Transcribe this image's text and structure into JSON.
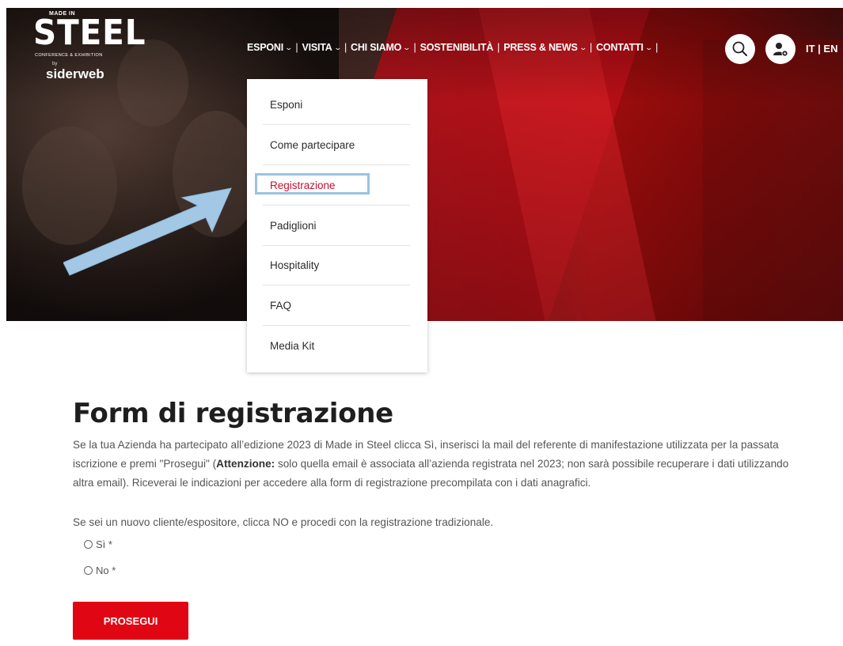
{
  "logo": {
    "made_in": "MADE IN",
    "steel": "STEEL",
    "subtitle": "CONFERENCE & EXHIBITION",
    "by": "by",
    "brand": "siderweb"
  },
  "nav": {
    "items": [
      {
        "label": "ESPONI",
        "has_dropdown": true
      },
      {
        "label": "VISITA",
        "has_dropdown": true
      },
      {
        "label": "CHI SIAMO",
        "has_dropdown": true
      },
      {
        "label": "SOSTENIBILITÀ",
        "has_dropdown": false
      },
      {
        "label": "PRESS & NEWS",
        "has_dropdown": true
      },
      {
        "label": "CONTATTI",
        "has_dropdown": true
      }
    ],
    "separator": "|",
    "chevron": "⌄",
    "search_icon": "search-icon",
    "user_icon": "user-settings-icon",
    "language": "IT | EN"
  },
  "dropdown": {
    "items": [
      {
        "label": "Esponi"
      },
      {
        "label": "Come partecipare"
      },
      {
        "label": "Registrazione",
        "active": true
      },
      {
        "label": "Padiglioni"
      },
      {
        "label": "Hospitality"
      },
      {
        "label": "FAQ"
      },
      {
        "label": "Media Kit"
      }
    ]
  },
  "form": {
    "title": "Form di registrazione",
    "intro_part1": "Se la tua Azienda ha partecipato all’edizione 2023 di Made in Steel clicca Sì, inserisci la mail del referente di manifestazione utilizzata per la passata iscrizione e premi \"Prosegui\" (",
    "intro_bold": "Attenzione:",
    "intro_part2": " solo quella email è associata all’azienda registrata nel 2023; non sarà possibile recuperare i dati utilizzando altra email). Riceverai le indicazioni per accedere alla form di registrazione precompilata con i dati anagrafici.",
    "intro_new": "Se sei un nuovo cliente/espositore, clicca NO e procedi con la registrazione tradizionale.",
    "option_yes": "Sì *",
    "option_no": "No *",
    "submit_label": "PROSEGUI"
  },
  "colors": {
    "accent_red": "#e10613",
    "active_link": "#c8102e",
    "highlight_box": "#9dc2df",
    "arrow": "#9dc2e3"
  }
}
